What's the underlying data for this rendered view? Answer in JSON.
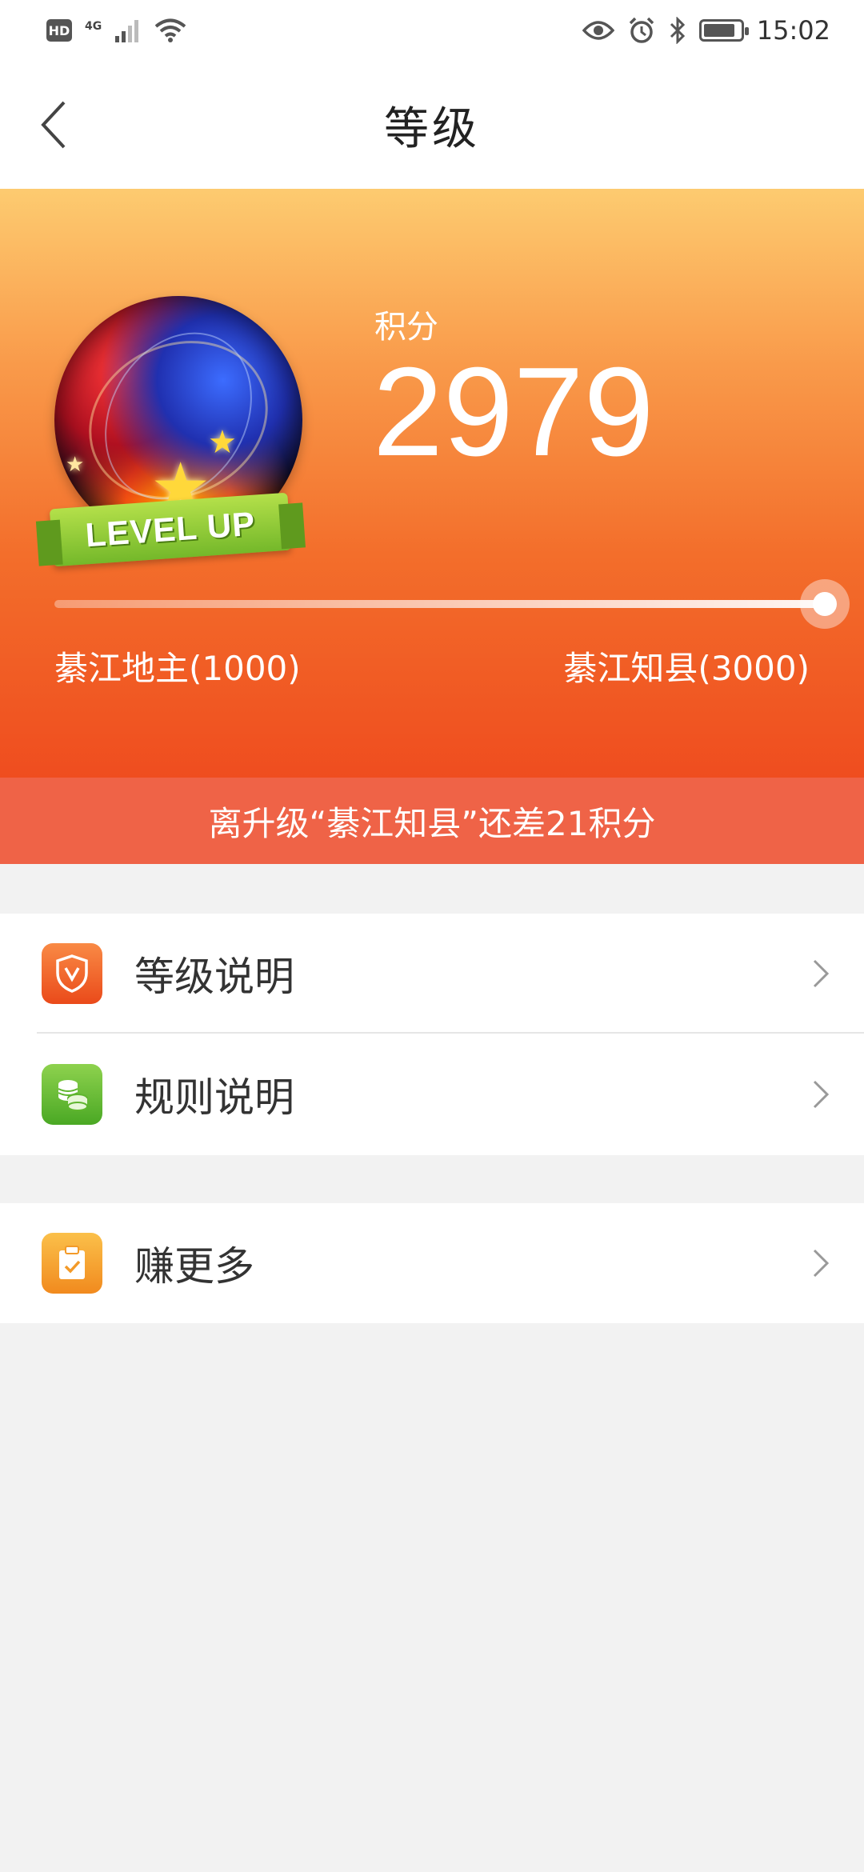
{
  "status_bar": {
    "hd": "HD",
    "network": "4G",
    "time": "15:02",
    "icons": [
      "signal-icon",
      "wifi-icon",
      "eye-icon",
      "alarm-icon",
      "bluetooth-icon",
      "battery-icon"
    ]
  },
  "nav": {
    "title": "等级",
    "back_icon": "back-arrow-icon"
  },
  "hero": {
    "badge_text": "LEVEL UP",
    "score_label": "积分",
    "score_value": "2979",
    "progress_fraction": 0.993,
    "current_level": "綦江地主(1000)",
    "next_level": "綦江知县(3000)",
    "colors": {
      "top": "#fdcb70",
      "bottom": "#ef4d1f"
    }
  },
  "hint": {
    "text": "离升级“綦江知县”还差21积分",
    "color": "#ef6347"
  },
  "menu": {
    "items": [
      {
        "label": "等级说明",
        "icon": "shield-v-icon"
      },
      {
        "label": "规则说明",
        "icon": "coins-icon"
      },
      {
        "label": "赚更多",
        "icon": "clipboard-check-icon"
      }
    ]
  }
}
